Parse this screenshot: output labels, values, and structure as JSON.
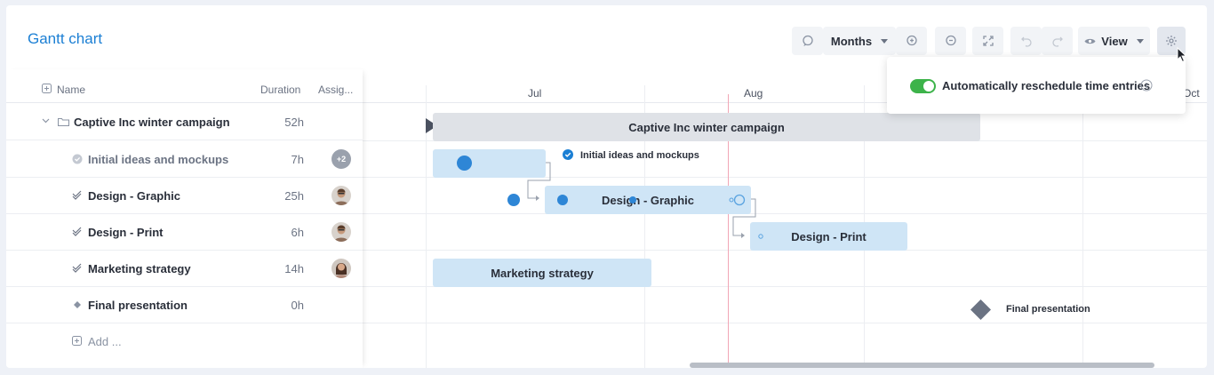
{
  "header": {
    "title": "Gantt chart"
  },
  "toolbar": {
    "scale": "Months",
    "view_label": "View"
  },
  "settings_popup": {
    "toggle_label": "Automatically reschedule time entries",
    "toggle_on": true
  },
  "columns": {
    "name": "Name",
    "duration": "Duration",
    "assignee": "Assig..."
  },
  "rows": [
    {
      "name": "Captive Inc winter campaign",
      "duration": "52h",
      "type": "group"
    },
    {
      "name": "Initial ideas and mockups",
      "duration": "7h",
      "type": "done",
      "assignee": "+2"
    },
    {
      "name": "Design - Graphic",
      "duration": "25h",
      "type": "task",
      "assignee": "avatar"
    },
    {
      "name": "Design - Print",
      "duration": "6h",
      "type": "task",
      "assignee": "avatar"
    },
    {
      "name": "Marketing strategy",
      "duration": "14h",
      "type": "task",
      "assignee": "avatar"
    },
    {
      "name": "Final presentation",
      "duration": "0h",
      "type": "milestone"
    }
  ],
  "add_label": "Add ...",
  "timeline": {
    "months": [
      "Jul",
      "Aug",
      "Oct"
    ]
  },
  "bars": {
    "group": "Captive Inc winter campaign",
    "initial_label": "Initial ideas and mockups",
    "graphic": "Design - Graphic",
    "print": "Design - Print",
    "marketing": "Marketing strategy",
    "milestone_label": "Final presentation"
  },
  "colors": {
    "accent": "#1b7fd4",
    "bar": "#cfe5f6",
    "group_bar": "#dfe2e7",
    "toggle": "#3db34a",
    "today": "#f2a6b5"
  }
}
